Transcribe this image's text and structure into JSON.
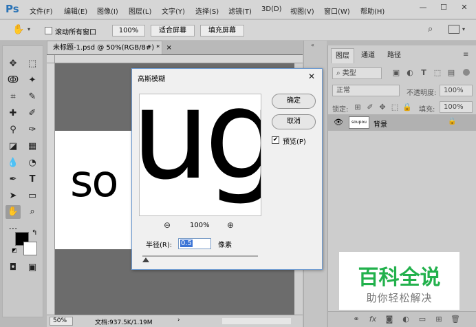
{
  "app": {
    "logo": "Ps",
    "menu": [
      "文件(F)",
      "编辑(E)",
      "图像(I)",
      "图层(L)",
      "文字(Y)",
      "选择(S)",
      "滤镜(T)",
      "3D(D)",
      "视图(V)",
      "窗口(W)",
      "帮助(H)"
    ],
    "window_buttons": [
      "—",
      "☐",
      "✕"
    ]
  },
  "options_bar": {
    "scroll_all_label": "滚动所有窗口",
    "zoom_value": "100%",
    "fit_screen": "适合屏幕",
    "fill_screen": "填充屏幕"
  },
  "document": {
    "tab_title": "未标题-1.psd @ 50%(RGB/8#) *",
    "tab_close": "×",
    "canvas_text": "so",
    "status_zoom": "50%",
    "status_doc": "文档:937.5K/1.19M"
  },
  "dialog": {
    "title": "高斯模糊",
    "preview_text": "ug",
    "ok": "确定",
    "cancel": "取消",
    "preview_label": "预览(P)",
    "preview_checked": true,
    "zoom_level": "100%",
    "radius_label": "半径(R):",
    "radius_value": "0.5",
    "unit": "像素"
  },
  "layers_panel": {
    "tabs": [
      "图层",
      "通道",
      "路径"
    ],
    "filter_label": "类型",
    "blend_mode": "正常",
    "opacity_label": "不透明度:",
    "opacity_value": "100%",
    "lock_label": "锁定:",
    "fill_label": "填充:",
    "fill_value": "100%",
    "layer_thumb_text": "soupou",
    "layer_name": "背景"
  },
  "watermark": {
    "title": "百科全说",
    "subtitle": "助你轻松解决"
  }
}
